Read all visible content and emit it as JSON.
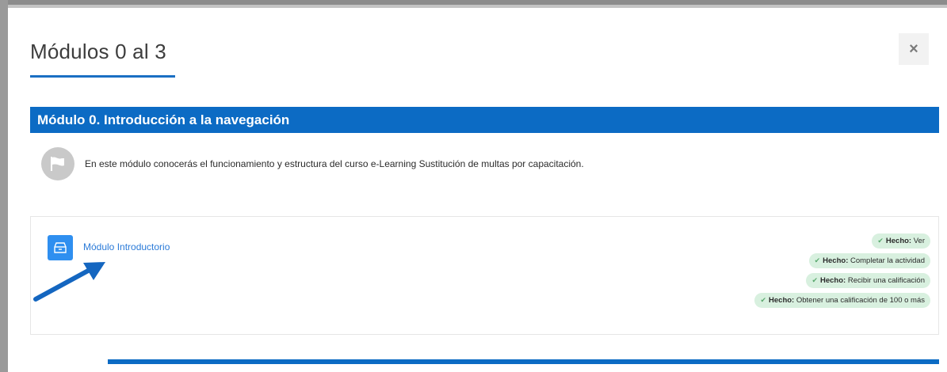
{
  "modal": {
    "title": "Módulos 0 al 3",
    "close_label": "×"
  },
  "section": {
    "title": "Módulo 0. Introducción a la navegación",
    "summary": "En este módulo conocerás el funcionamiento y estructura del curso e-Learning Sustitución de multas por capacitación.",
    "summary_icon": "flag-icon"
  },
  "activity": {
    "icon": "scorm-package-icon",
    "name": "Módulo Introductorio",
    "completion": [
      {
        "label": "Hecho:",
        "text": "Ver"
      },
      {
        "label": "Hecho:",
        "text": "Completar la actividad"
      },
      {
        "label": "Hecho:",
        "text": "Recibir una calificación"
      },
      {
        "label": "Hecho:",
        "text": "Obtener una calificación de 100 o más"
      }
    ]
  },
  "colors": {
    "accent": "#0c6bc4",
    "badge_bg": "#d8f0df",
    "link": "#2a7ad8"
  }
}
